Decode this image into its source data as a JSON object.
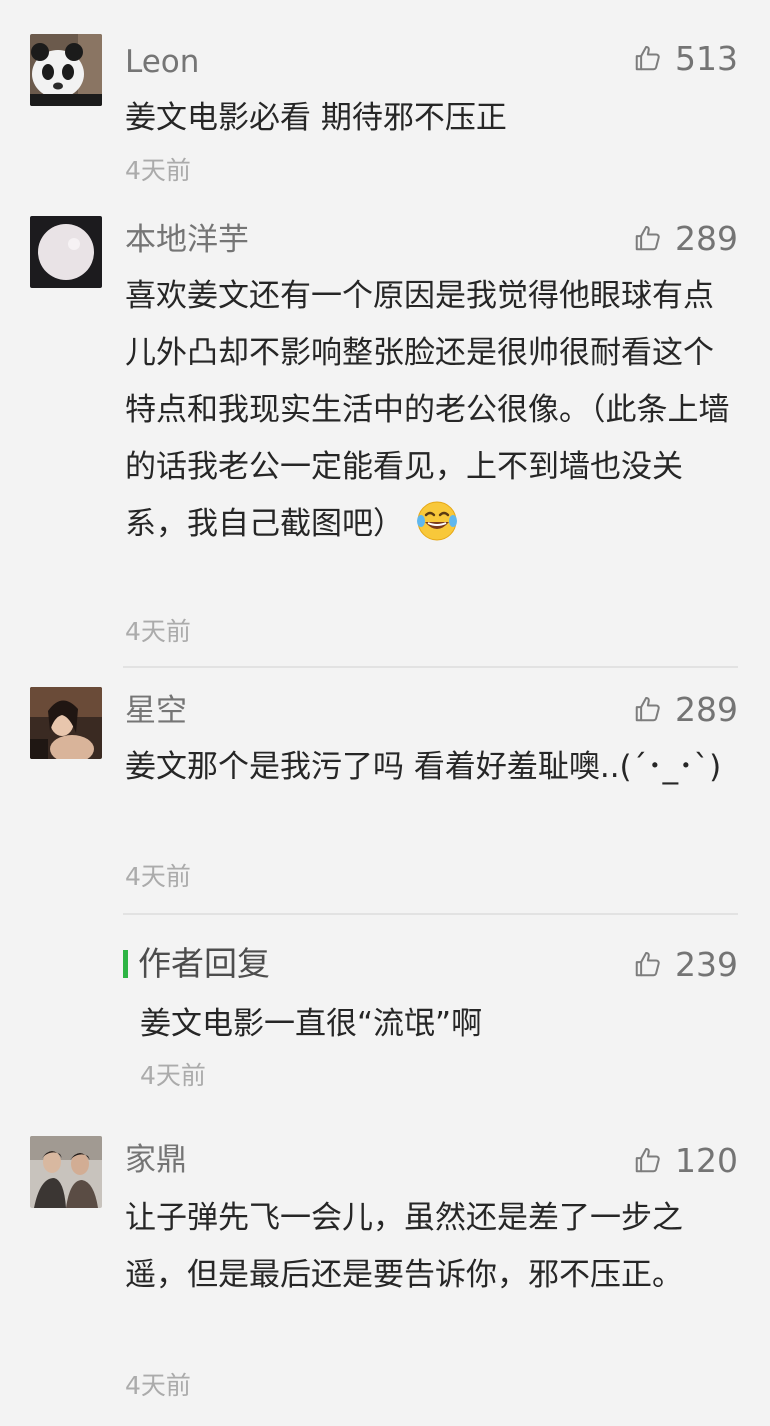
{
  "comments": [
    {
      "name": "Leon",
      "likes": "513",
      "text": "姜文电影必看 期待邪不压正",
      "time": "4天前",
      "avatar": "panda-avatar"
    },
    {
      "name": "本地洋芋",
      "likes": "289",
      "text": "喜欢姜文还有一个原因是我觉得他眼球有点儿外凸却不影响整张脸还是很帅很耐看这个特点和我现实生活中的老公很像。（此条上墙的话我老公一定能看见，上不到墙也没关系，我自己截图吧）",
      "time": "4天前",
      "avatar": "moon-avatar",
      "emoji": "laughing-tears-emoji"
    },
    {
      "name": "星空",
      "likes": "289",
      "text": "姜文那个是我污了吗 看着好羞耻噢..(´･_･`)",
      "time": "4天前",
      "avatar": "woman-avatar"
    },
    {
      "name": "家鼎",
      "likes": "120",
      "text": "让子弹先飞一会儿，虽然还是差了一步之遥，但是最后还是要告诉你，邪不压正。",
      "time": "4天前",
      "avatar": "couple-avatar"
    }
  ],
  "author_reply": {
    "label": "作者回复",
    "likes": "239",
    "text": "姜文电影一直很“流氓”啊",
    "time": "4天前"
  },
  "colors": {
    "background": "#f3f3f3",
    "reply_accent": "#2db444",
    "meta": "#ababab"
  },
  "icons": {
    "like": "thumbs-up-icon"
  }
}
